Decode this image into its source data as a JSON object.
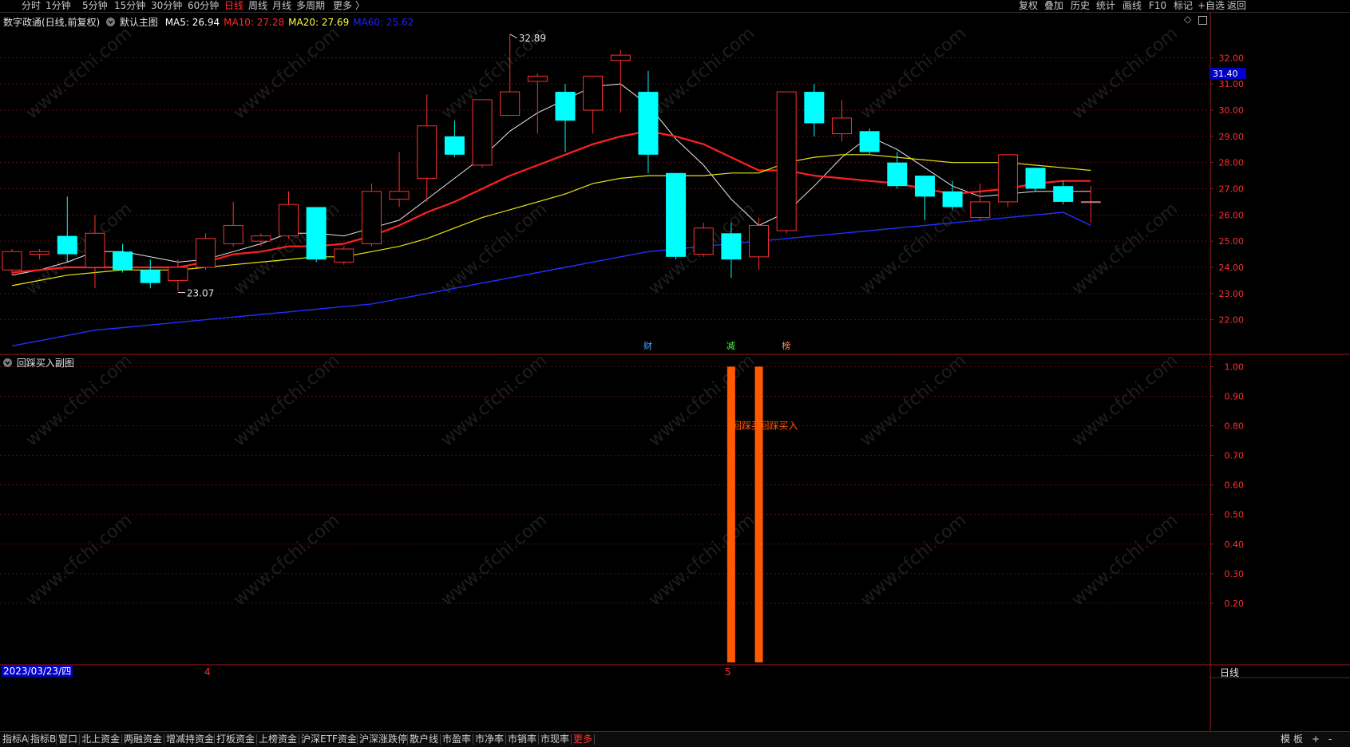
{
  "top_bar": {
    "periods": [
      "分时",
      "1分钟",
      "5分钟",
      "15分钟",
      "30分钟",
      "60分钟",
      "日线",
      "周线",
      "月线",
      "多周期",
      "更多 〉"
    ],
    "active_period": "日线",
    "tools": [
      "复权",
      "叠加",
      "历史",
      "统计",
      "画线",
      "F10",
      "标记",
      "+自选",
      "返回"
    ]
  },
  "main_panel": {
    "title": "数字政通(日线,前复权)",
    "theme": "默认主图",
    "legend": [
      {
        "label": "MA5: 26.94",
        "color": "#ffffff"
      },
      {
        "label": "MA10: 27.28",
        "color": "#ff2a2a"
      },
      {
        "label": "MA20: 27.69",
        "color": "#ffff40"
      },
      {
        "label": "MA60: 25.62",
        "color": "#2020ff"
      }
    ],
    "current_price_label": "31.40",
    "high_annotation": "32.89",
    "low_annotation": "23.07",
    "event_markers": [
      {
        "label": "财",
        "color": "#4aa8ff"
      },
      {
        "label": "减",
        "color": "#40ff40"
      },
      {
        "label": "榜",
        "color": "#ff9040"
      }
    ]
  },
  "sub_panel": {
    "title": "回踩买入副图",
    "signal_labels": [
      "回踩买",
      "回踩买入"
    ]
  },
  "date_axis": {
    "cursor_date": "2023/03/23/四",
    "month_labels": [
      "4",
      "5"
    ]
  },
  "corner_label": "日线",
  "bottom_bar": {
    "tabs": [
      "指标A",
      "指标B",
      "窗口",
      "北上资金",
      "两融资金",
      "增减持资金",
      "打板资金",
      "上榜资金",
      "沪深ETF资金",
      "沪深涨跌停",
      "散户线",
      "市盈率",
      "市净率",
      "市销率",
      "市现率",
      "更多"
    ],
    "active_tab": "更多",
    "right_controls": [
      "模",
      "板",
      "+",
      "-"
    ]
  },
  "watermark": "www.cfchi.com",
  "chart_data": [
    {
      "type": "candlestick",
      "title": "数字政通(日线,前复权)",
      "y_ticks": [
        "22.00",
        "23.00",
        "24.00",
        "25.00",
        "26.00",
        "27.00",
        "28.00",
        "29.00",
        "30.00",
        "31.00",
        "32.00"
      ],
      "ylim": [
        20.8,
        33.2
      ],
      "up_color": "#ff3030",
      "down_color": "#00ffff",
      "candles": [
        {
          "o": 23.9,
          "h": 24.7,
          "l": 23.7,
          "c": 24.6
        },
        {
          "o": 24.5,
          "h": 24.7,
          "l": 24.3,
          "c": 24.6
        },
        {
          "o": 25.2,
          "h": 26.7,
          "l": 24.2,
          "c": 24.5
        },
        {
          "o": 24.0,
          "h": 26.0,
          "l": 23.2,
          "c": 25.3
        },
        {
          "o": 24.6,
          "h": 24.9,
          "l": 23.8,
          "c": 23.9
        },
        {
          "o": 23.9,
          "h": 24.3,
          "l": 23.2,
          "c": 23.4
        },
        {
          "o": 23.5,
          "h": 24.3,
          "l": 23.1,
          "c": 24.0
        },
        {
          "o": 24.0,
          "h": 25.3,
          "l": 23.9,
          "c": 25.1
        },
        {
          "o": 24.9,
          "h": 26.5,
          "l": 24.8,
          "c": 25.6
        },
        {
          "o": 25.0,
          "h": 25.3,
          "l": 24.8,
          "c": 25.2
        },
        {
          "o": 25.2,
          "h": 26.9,
          "l": 25.1,
          "c": 26.4
        },
        {
          "o": 26.3,
          "h": 26.3,
          "l": 24.2,
          "c": 24.3
        },
        {
          "o": 24.2,
          "h": 24.8,
          "l": 24.1,
          "c": 24.7
        },
        {
          "o": 24.9,
          "h": 27.2,
          "l": 24.8,
          "c": 26.9
        },
        {
          "o": 26.6,
          "h": 28.4,
          "l": 26.3,
          "c": 26.9
        },
        {
          "o": 27.4,
          "h": 30.6,
          "l": 26.5,
          "c": 29.4
        },
        {
          "o": 29.0,
          "h": 29.6,
          "l": 28.2,
          "c": 28.3
        },
        {
          "o": 27.9,
          "h": 30.4,
          "l": 27.8,
          "c": 30.4
        },
        {
          "o": 29.8,
          "h": 32.9,
          "l": 29.8,
          "c": 30.7
        },
        {
          "o": 31.1,
          "h": 31.4,
          "l": 29.1,
          "c": 31.3
        },
        {
          "o": 30.7,
          "h": 31.0,
          "l": 28.4,
          "c": 29.6
        },
        {
          "o": 30.0,
          "h": 31.3,
          "l": 29.1,
          "c": 31.3
        },
        {
          "o": 31.9,
          "h": 32.3,
          "l": 29.9,
          "c": 32.1
        },
        {
          "o": 30.7,
          "h": 31.5,
          "l": 27.6,
          "c": 28.3
        },
        {
          "o": 27.6,
          "h": 27.6,
          "l": 24.3,
          "c": 24.4
        },
        {
          "o": 24.5,
          "h": 25.7,
          "l": 24.4,
          "c": 25.5
        },
        {
          "o": 25.3,
          "h": 25.7,
          "l": 23.6,
          "c": 24.3
        },
        {
          "o": 24.4,
          "h": 25.9,
          "l": 23.9,
          "c": 25.6
        },
        {
          "o": 25.4,
          "h": 30.7,
          "l": 25.3,
          "c": 30.7
        },
        {
          "o": 30.7,
          "h": 31.0,
          "l": 29.0,
          "c": 29.5
        },
        {
          "o": 29.1,
          "h": 30.4,
          "l": 28.8,
          "c": 29.7
        },
        {
          "o": 29.2,
          "h": 29.3,
          "l": 28.3,
          "c": 28.4
        },
        {
          "o": 28.0,
          "h": 28.4,
          "l": 27.0,
          "c": 27.1
        },
        {
          "o": 27.5,
          "h": 27.5,
          "l": 25.8,
          "c": 26.7
        },
        {
          "o": 26.9,
          "h": 27.3,
          "l": 26.2,
          "c": 26.3
        },
        {
          "o": 25.9,
          "h": 27.2,
          "l": 25.8,
          "c": 26.5
        },
        {
          "o": 26.5,
          "h": 28.3,
          "l": 26.3,
          "c": 28.3
        },
        {
          "o": 27.8,
          "h": 27.8,
          "l": 26.9,
          "c": 27.0
        },
        {
          "o": 27.1,
          "h": 27.3,
          "l": 26.4,
          "c": 26.5
        },
        {
          "o": 26.5,
          "h": 27.1,
          "l": 25.7,
          "c": 26.5
        }
      ],
      "series": [
        {
          "name": "MA5",
          "color": "#e8e8e8",
          "width": 1,
          "values": [
            23.7,
            23.9,
            24.2,
            24.6,
            24.6,
            24.4,
            24.2,
            24.3,
            24.6,
            24.9,
            25.3,
            25.3,
            25.2,
            25.5,
            25.8,
            26.6,
            27.4,
            28.2,
            29.2,
            29.9,
            30.4,
            30.9,
            31.0,
            30.2,
            28.9,
            27.9,
            26.6,
            25.6,
            26.1,
            27.1,
            28.2,
            29.0,
            28.5,
            27.8,
            27.1,
            26.7,
            26.8,
            26.9,
            26.9,
            26.9
          ]
        },
        {
          "name": "MA10",
          "color": "#ff2020",
          "width": 2.2,
          "values": [
            23.8,
            23.9,
            24.0,
            24.0,
            24.0,
            24.0,
            24.0,
            24.2,
            24.5,
            24.6,
            24.8,
            24.8,
            24.9,
            25.2,
            25.6,
            26.1,
            26.5,
            27.0,
            27.5,
            27.9,
            28.3,
            28.7,
            29.0,
            29.2,
            29.0,
            28.7,
            28.2,
            27.7,
            27.7,
            27.5,
            27.4,
            27.3,
            27.2,
            27.0,
            26.8,
            26.9,
            27.0,
            27.2,
            27.3,
            27.3
          ]
        },
        {
          "name": "MA20",
          "color": "#e8e810",
          "width": 1.2,
          "values": [
            23.3,
            23.5,
            23.7,
            23.8,
            23.9,
            23.9,
            23.9,
            24.0,
            24.1,
            24.2,
            24.3,
            24.4,
            24.4,
            24.6,
            24.8,
            25.1,
            25.5,
            25.9,
            26.2,
            26.5,
            26.8,
            27.2,
            27.4,
            27.5,
            27.5,
            27.5,
            27.6,
            27.6,
            28.0,
            28.2,
            28.3,
            28.3,
            28.2,
            28.1,
            28.0,
            28.0,
            28.0,
            27.9,
            27.8,
            27.7
          ]
        },
        {
          "name": "MA60",
          "color": "#2030ff",
          "width": 1.4,
          "values": [
            21.0,
            21.2,
            21.4,
            21.6,
            21.7,
            21.8,
            21.9,
            22.0,
            22.1,
            22.2,
            22.3,
            22.4,
            22.5,
            22.6,
            22.8,
            23.0,
            23.2,
            23.4,
            23.6,
            23.8,
            24.0,
            24.2,
            24.4,
            24.6,
            24.7,
            24.8,
            24.9,
            25.0,
            25.1,
            25.2,
            25.3,
            25.4,
            25.5,
            25.6,
            25.7,
            25.8,
            25.9,
            26.0,
            26.1,
            25.6
          ]
        }
      ]
    },
    {
      "type": "bar",
      "title": "回踩买入副图",
      "y_ticks": [
        "0.20",
        "0.30",
        "0.40",
        "0.50",
        "0.60",
        "0.70",
        "0.80",
        "0.90",
        "1.00"
      ],
      "ylim": [
        0,
        1.02
      ],
      "signals": [
        {
          "index": 26,
          "value": 1.0
        },
        {
          "index": 27,
          "value": 1.0
        }
      ],
      "color": "#ff5a00"
    }
  ]
}
